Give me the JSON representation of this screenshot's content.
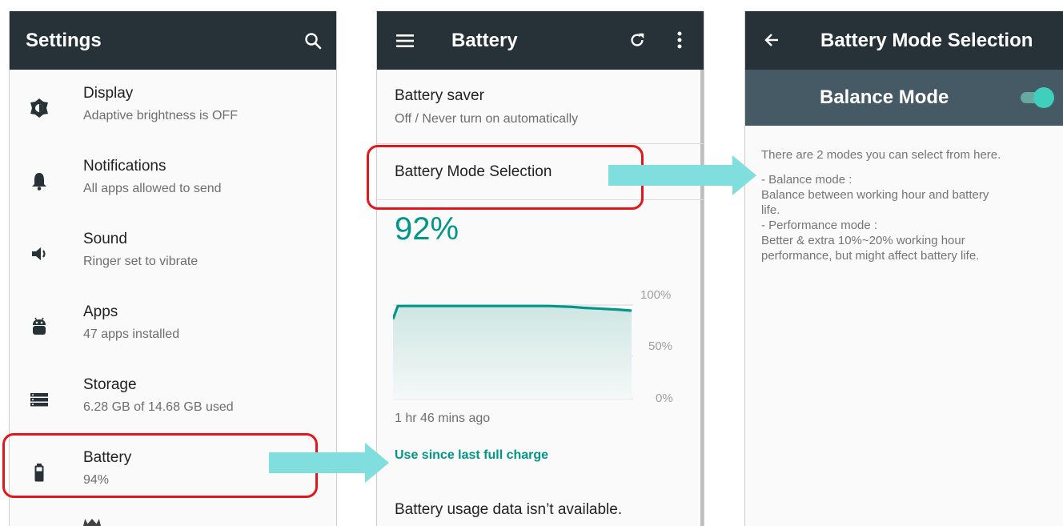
{
  "settings": {
    "title": "Settings",
    "items": [
      {
        "title": "Display",
        "subtitle": "Adaptive brightness is OFF",
        "icon": "brightness-icon"
      },
      {
        "title": "Notifications",
        "subtitle": "All apps allowed to send",
        "icon": "bell-icon"
      },
      {
        "title": "Sound",
        "subtitle": "Ringer set to vibrate",
        "icon": "speaker-icon"
      },
      {
        "title": "Apps",
        "subtitle": "47 apps installed",
        "icon": "android-icon"
      },
      {
        "title": "Storage",
        "subtitle": "6.28 GB of 14.68 GB used",
        "icon": "storage-icon"
      },
      {
        "title": "Battery",
        "subtitle": "94%",
        "icon": "battery-icon"
      }
    ]
  },
  "battery": {
    "title": "Battery",
    "saver_title": "Battery saver",
    "saver_subtitle": "Off / Never turn on automatically",
    "mode_selection": "Battery Mode Selection",
    "percent": "92%",
    "chart_labels": {
      "top": "100%",
      "mid": "50%",
      "bottom": "0%"
    },
    "time_ago": "1 hr 46 mins ago",
    "link": "Use since last full charge",
    "usage_note": "Battery usage data isn’t available."
  },
  "chart_data": {
    "type": "area",
    "ylim": [
      0,
      100
    ],
    "yticks": [
      "100%",
      "50%",
      "0%"
    ],
    "x": [
      0,
      0.02,
      0.1,
      0.3,
      0.5,
      0.65,
      0.75,
      0.8,
      0.88,
      0.95,
      1.0
    ],
    "values": [
      85,
      99,
      99,
      99,
      99,
      99,
      98,
      97,
      96,
      95,
      94
    ]
  },
  "mode": {
    "title": "Battery Mode Selection",
    "toggle_label": "Balance Mode",
    "toggle_on": true,
    "description": [
      "There are 2 modes you can select from here.",
      "",
      "- Balance mode :",
      "Balance between working hour and battery",
      "life.",
      "- Performance mode :",
      "Better & extra 10%~20% working hour",
      "performance, but might affect battery life."
    ]
  },
  "colors": {
    "appbar": "#263238",
    "accent": "#009688",
    "toggle_bar": "#455a64",
    "highlight": "#e3161b",
    "arrow": "#80dede"
  }
}
